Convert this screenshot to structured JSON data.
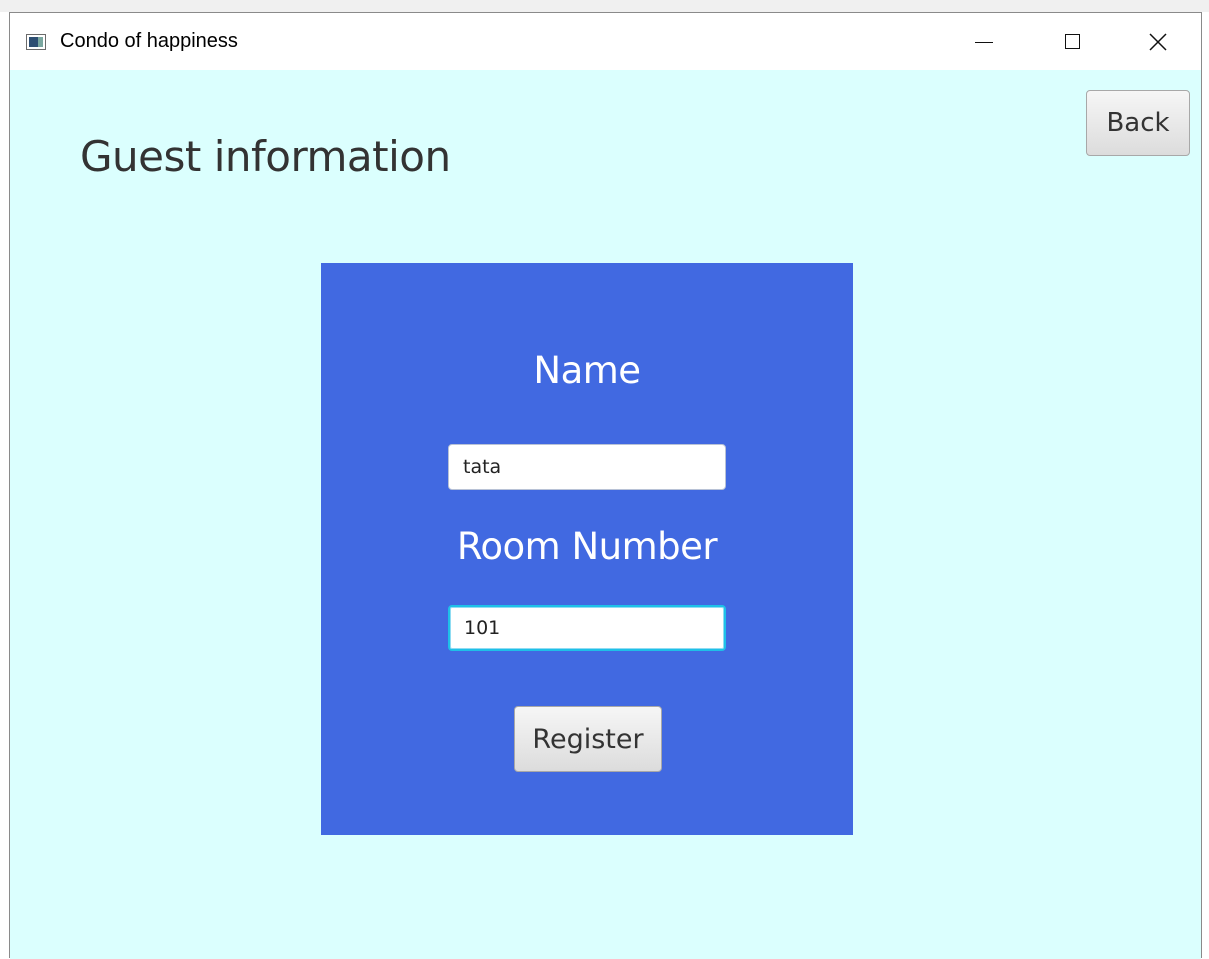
{
  "window": {
    "title": "Condo of happiness",
    "controls": {
      "minimize": "minimize-icon",
      "maximize": "maximize-icon",
      "close": "close-icon"
    }
  },
  "page": {
    "title": "Guest information",
    "back_label": "Back",
    "background_color": "#dbfffe"
  },
  "form": {
    "panel_color": "#4169e1",
    "name_label": "Name",
    "name_value": "tata",
    "room_label": "Room Number",
    "room_value": "101",
    "register_label": "Register"
  }
}
